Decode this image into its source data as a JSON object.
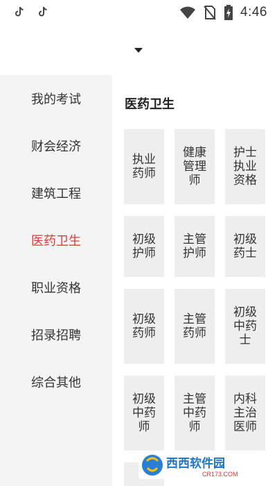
{
  "status_bar": {
    "time": "4:46",
    "icons": [
      "tiktok-icon",
      "tiktok-icon",
      "wifi-icon",
      "no-sim-icon",
      "battery-charging-icon"
    ]
  },
  "header": {
    "dropdown_icon": "caret-down-icon"
  },
  "sidebar": {
    "items": [
      {
        "label": "我的考试",
        "active": false
      },
      {
        "label": "财会经济",
        "active": false
      },
      {
        "label": "建筑工程",
        "active": false
      },
      {
        "label": "医药卫生",
        "active": true
      },
      {
        "label": "职业资格",
        "active": false
      },
      {
        "label": "招录招聘",
        "active": false
      },
      {
        "label": "综合其他",
        "active": false
      }
    ]
  },
  "main": {
    "section_title": "医药卫生",
    "cards": [
      "执业药师",
      "健康管理师",
      "护士执业资格",
      "初级护师",
      "主管护师",
      "初级药士",
      "初级药师",
      "主管药师",
      "初级中药士",
      "初级中药师",
      "主管中药师",
      "内科主治医师"
    ]
  },
  "colors": {
    "accent": "#e53935",
    "sidebar_bg": "#f4f4f4",
    "card_bg": "#eeeeee",
    "text": "#333333"
  },
  "watermark": {
    "brand": "西西软件园",
    "url": "CR173.COM"
  }
}
